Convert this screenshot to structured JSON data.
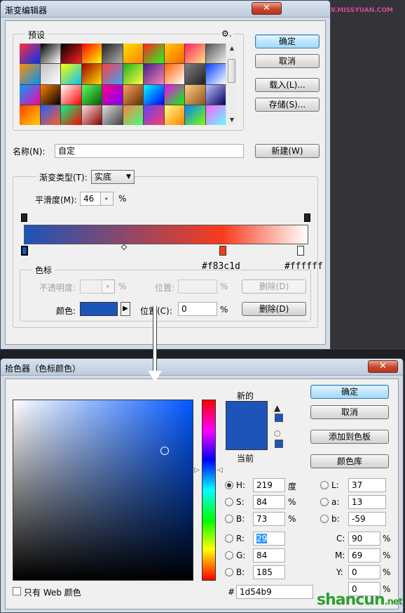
{
  "gradient_editor": {
    "title": "渐变编辑器",
    "presets_label": "预设",
    "gear_glyph": "⚙.",
    "buttons": {
      "ok": "确定",
      "cancel": "取消",
      "load": "载入(L)...",
      "save": "存储(S)...",
      "new": "新建(W)"
    },
    "name_label": "名称(N):",
    "name_value": "自定",
    "gradient_type_label": "渐变类型(T):",
    "gradient_type_value": "实底",
    "smoothness_label": "平滑度(M):",
    "smoothness_value": "46",
    "percent_sign": "%",
    "stop_hex_red": "#f83c1d",
    "stop_hex_white": "#ffffff",
    "stops_group_label": "色标",
    "opacity_label": "不透明度:",
    "location_label_opacity": "位置:",
    "delete_label_opacity": "删除(D)",
    "color_label": "颜色:",
    "location_label_color": "位置(C):",
    "location_value": "0",
    "delete_label_color": "删除(D)",
    "preset_colors": [
      [
        "#ff3030",
        "#0030ff"
      ],
      [
        "#000000",
        "#ffffff"
      ],
      [
        "#000000",
        "#ff2020"
      ],
      [
        "#ff0000",
        "#ffff00"
      ],
      [
        "#202020",
        "#b0b0b0"
      ],
      [
        "#ffe000",
        "#ff8000"
      ],
      [
        "#ff2020",
        "#20ff20"
      ],
      [
        "#ffd000",
        "#ff6000"
      ],
      [
        "#ff2060",
        "#ffe080"
      ],
      [
        "#505050",
        "#f0f0f0"
      ],
      [
        "#ff9000",
        "#0090ff"
      ],
      [
        "#c0c0c0",
        "#ffffff"
      ],
      [
        "#ffff00",
        "#00c0ff"
      ],
      [
        "#a00000",
        "#ffe000"
      ],
      [
        "#ff4040",
        "#40a0ff"
      ],
      [
        "#20b020",
        "#ffff40"
      ],
      [
        "#402080",
        "#ff80c0"
      ],
      [
        "#ff6000",
        "#ffffff"
      ],
      [
        "#808080",
        "#202020"
      ],
      [
        "#0040ff",
        "#ffffff"
      ],
      [
        "#00a0ff",
        "#ff00a0"
      ],
      [
        "#ff8000",
        "#000000"
      ],
      [
        "#ffffff",
        "#ff0000"
      ],
      [
        "#60ff60",
        "#006000"
      ],
      [
        "#ff0080",
        "#8000ff"
      ],
      [
        "#ffa060",
        "#603000"
      ],
      [
        "#00ffff",
        "#0000ff"
      ],
      [
        "#ff00ff",
        "#00ff00"
      ],
      [
        "#ffd080",
        "#905020"
      ],
      [
        "#c0c0ff",
        "#000060"
      ],
      [
        "#ff4000",
        "#ffd000"
      ],
      [
        "#2060ff",
        "#ff6020"
      ],
      [
        "#00ff80",
        "#ff0000"
      ],
      [
        "#ffe0e0",
        "#800000"
      ],
      [
        "#e0e0e0",
        "#404040"
      ],
      [
        "#ff8040",
        "#40ff80"
      ],
      [
        "#6040ff",
        "#ff4060"
      ],
      [
        "#ffff80",
        "#ff8000"
      ],
      [
        "#0080ff",
        "#80ff00"
      ],
      [
        "#ff60ff",
        "#60ffff"
      ]
    ]
  },
  "color_picker": {
    "title": "拾色器（色标颜色）",
    "new_label": "新的",
    "current_label": "当前",
    "buttons": {
      "ok": "确定",
      "cancel": "取消",
      "add_to_swatches": "添加到色板",
      "color_libraries": "颜色库"
    },
    "hsb": {
      "h_label": "H:",
      "h_value": "219",
      "h_unit": "度",
      "s_label": "S:",
      "s_value": "84",
      "s_unit": "%",
      "b_label": "B:",
      "b_value": "73",
      "b_unit": "%"
    },
    "lab": {
      "l_label": "L:",
      "l_value": "37",
      "a_label": "a:",
      "a_value": "13",
      "b_label": "b:",
      "b_value": "-59"
    },
    "rgb": {
      "r_label": "R:",
      "r_value": "29",
      "g_label": "G:",
      "g_value": "84",
      "b_label": "B:",
      "b_value": "185"
    },
    "cmyk": {
      "c_label": "C:",
      "c_value": "90",
      "c_unit": "%",
      "m_label": "M:",
      "m_value": "69",
      "m_unit": "%",
      "y_label": "Y:",
      "y_value": "0",
      "y_unit": "%",
      "k_value": "0",
      "k_unit": "%"
    },
    "hex_label": "#",
    "hex_value": "1d54b9",
    "web_only_label": "只有 Web 颜色"
  },
  "watermark_top": "ps教程论坛 WWW.MISSYUAN.COM",
  "watermark_bottom_main": "shancun",
  "watermark_bottom_sub": ".net",
  "colors": {
    "selected_color": "#1d54b9",
    "stop_red": "#f83c1d",
    "stop_white": "#ffffff"
  }
}
